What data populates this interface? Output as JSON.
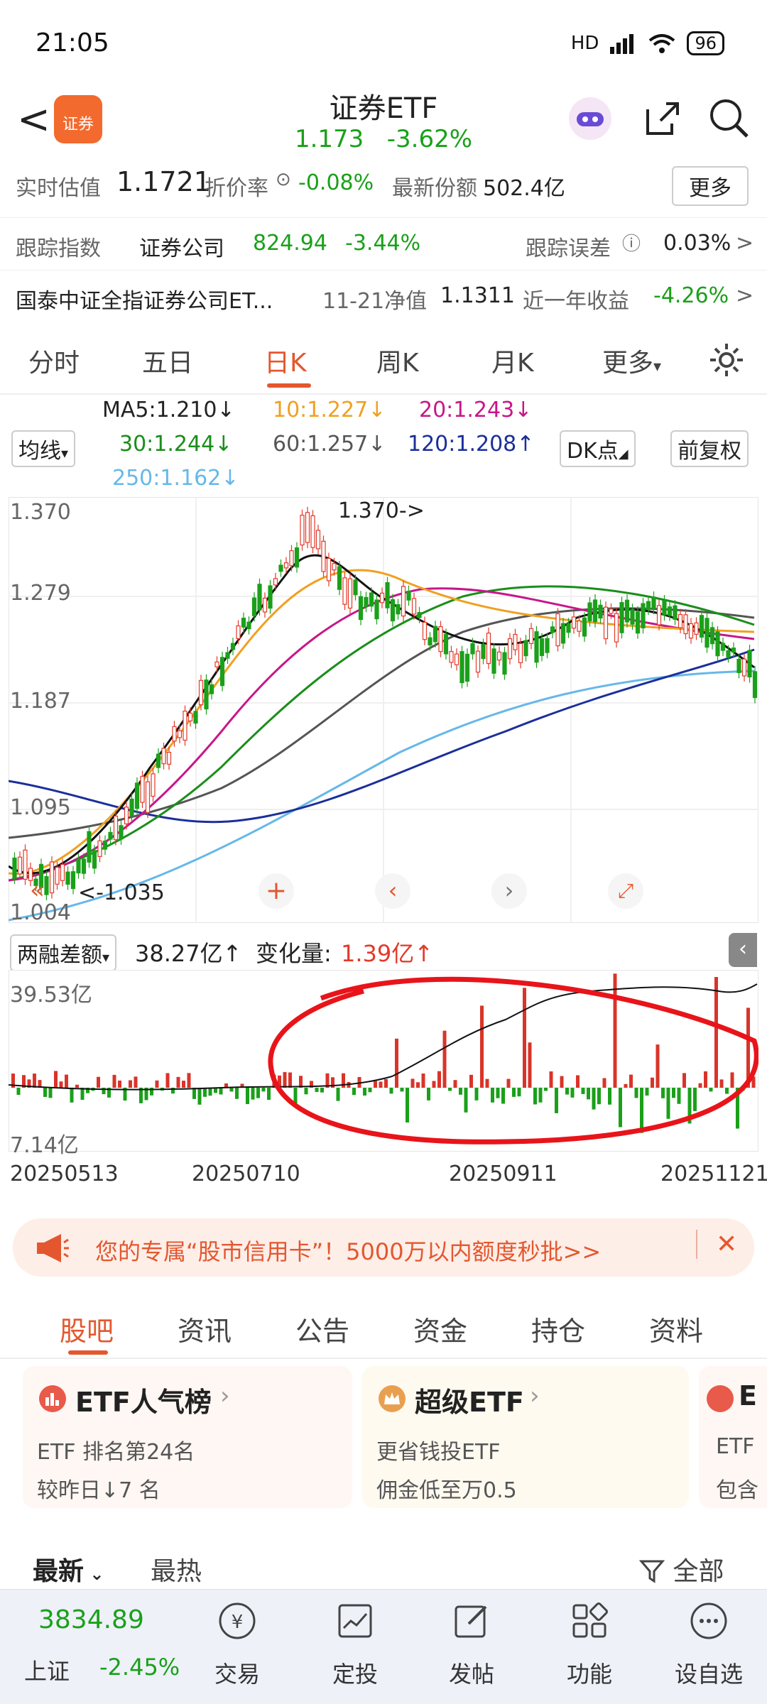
{
  "status": {
    "time": "21:05",
    "network": "HD",
    "battery": "96"
  },
  "header": {
    "back": "<",
    "logo_text": "证券",
    "title": "证券ETF",
    "price": "1.173",
    "change": "-3.62%"
  },
  "info_row1": {
    "est_label": "实时估值",
    "est_value": "1.1721",
    "discount_label": "折价率",
    "discount_value": "-0.08%",
    "shares_label": "最新份额",
    "shares_value": "502.4亿",
    "more_button": "更多"
  },
  "info_row2": {
    "index_label": "跟踪指数",
    "index_name": "证券公司",
    "index_value": "824.94",
    "index_change": "-3.44%",
    "error_label": "跟踪误差",
    "error_value": "0.03%",
    "chevron": ">"
  },
  "info_row3": {
    "fund_name": "国泰中证全指证券公司ET...",
    "nav_label": "11-21净值",
    "nav_value": "1.1311",
    "year_label": "近一年收益",
    "year_value": "-4.26%",
    "chevron": ">"
  },
  "tabs": [
    "分时",
    "五日",
    "日K",
    "周K",
    "月K",
    "更多"
  ],
  "ma": {
    "selector": "均线",
    "ma5": "MA5:1.210↓",
    "ma10": "10:1.227↓",
    "ma20": "20:1.243↓",
    "ma30": "30:1.244↓",
    "ma60": "60:1.257↓",
    "ma120": "120:1.208↑",
    "ma250": "250:1.162↓",
    "dk_button": "DK点",
    "adjust_button": "前复权"
  },
  "chart_labels": {
    "y1": "1.370",
    "y2": "1.279",
    "y3": "1.187",
    "y4": "1.095",
    "y5": "1.004",
    "high": "1.370->",
    "low": "<-1.035"
  },
  "sub_indicator": {
    "name": "两融差额",
    "value": "38.27亿↑",
    "change_label": "变化量:",
    "change_value": "1.39亿↑",
    "top": "39.53亿",
    "bottom": "7.14亿"
  },
  "dates": [
    "20250513",
    "20250710",
    "20250911",
    "20251121"
  ],
  "banner": {
    "text": "您的专属“股市信用卡”！5000万以内额度秒批>>",
    "close": "✕"
  },
  "tabs2": [
    "股吧",
    "资讯",
    "公告",
    "资金",
    "持仓",
    "资料"
  ],
  "cards": [
    {
      "title": "ETF人气榜",
      "line1": "ETF 排名第24名",
      "line2": "较昨日↓7 名"
    },
    {
      "title": "超级ETF",
      "line1": "更省钱投ETF",
      "line2": "佣金低至万0.5"
    },
    {
      "title": "E",
      "line1": "ETF",
      "line2": "包含"
    }
  ],
  "sort": {
    "latest": "最新",
    "hot": "最热",
    "filter": "全部"
  },
  "bottom_nav": {
    "index_value": "3834.89",
    "index_name": "上证",
    "index_change": "-2.45%",
    "items": [
      "交易",
      "定投",
      "发帖",
      "功能",
      "设自选"
    ]
  },
  "colors": {
    "up": "#e23a2a",
    "down": "#1aa01a",
    "accent": "#e4572e"
  }
}
